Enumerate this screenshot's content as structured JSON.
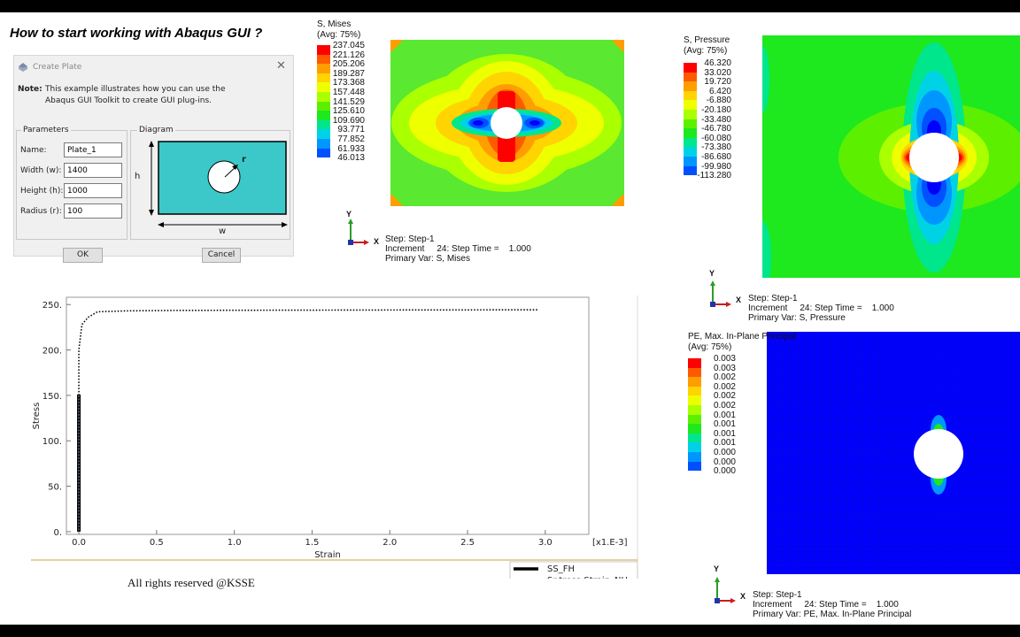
{
  "title": "How to start working  with Abaqus GUI  ?",
  "dialog": {
    "title": "Create Plate",
    "note_label": "Note:",
    "note_line1": "This example illustrates how you can use the",
    "note_line2": "Abaqus GUI Toolkit to create GUI plug-ins.",
    "parameters_label": "Parameters",
    "diagram_label": "Diagram",
    "fields": [
      {
        "label": "Name:",
        "value": "Plate_1"
      },
      {
        "label": "Width (w):",
        "value": "1400"
      },
      {
        "label": "Height (h):",
        "value": "1000"
      },
      {
        "label": "Radius (r):",
        "value": "100"
      }
    ],
    "diagram": {
      "h": "h",
      "w": "w",
      "r": "r"
    },
    "ok_label": "OK",
    "cancel_label": "Cancel"
  },
  "mises_plot": {
    "legend_title1": "S, Mises",
    "legend_title2": "(Avg: 75%)",
    "values": [
      "237.045",
      "221.126",
      "205.206",
      "189.287",
      "173.368",
      "157.448",
      "141.529",
      "125.610",
      "109.690",
      "93.771",
      "77.852",
      "61.933",
      "46.013"
    ],
    "colors": [
      "#ff0000",
      "#ff5a00",
      "#ff9e00",
      "#ffd400",
      "#eeff00",
      "#aaff00",
      "#5cf000",
      "#1ee81e",
      "#00e68c",
      "#00d2e6",
      "#0096ff",
      "#0050ff",
      "#0000ff"
    ],
    "axis_y": "Y",
    "axis_x": "X",
    "info_line1": "Step: Step-1",
    "info_line2": "Increment     24: Step Time =    1.000",
    "info_line3": "Primary Var: S, Mises"
  },
  "pressure_plot": {
    "legend_title1": "S, Pressure",
    "legend_title2": "(Avg: 75%)",
    "values": [
      "46.320",
      "33.020",
      "19.720",
      "6.420",
      "-6.880",
      "-20.180",
      "-33.480",
      "-46.780",
      "-60.080",
      "-73.380",
      "-86.680",
      "-99.980",
      "-113.280"
    ],
    "colors": [
      "#ff0000",
      "#ff5a00",
      "#ff9e00",
      "#ffd400",
      "#eeff00",
      "#aaff00",
      "#5cf000",
      "#1ee81e",
      "#00e68c",
      "#00d2e6",
      "#0096ff",
      "#0050ff",
      "#0000ff"
    ],
    "axis_y": "Y",
    "axis_x": "X",
    "info_line1": "Step: Step-1",
    "info_line2": "Increment     24: Step Time =    1.000",
    "info_line3": "Primary Var: S, Pressure"
  },
  "pe_plot": {
    "legend_title1": "PE, Max. In-Plane Principal",
    "legend_title2": "(Avg: 75%)",
    "values": [
      "0.003",
      "0.003",
      "0.002",
      "0.002",
      "0.002",
      "0.002",
      "0.001",
      "0.001",
      "0.001",
      "0.001",
      "0.000",
      "0.000",
      "0.000"
    ],
    "colors": [
      "#ff0000",
      "#ff5a00",
      "#ff9e00",
      "#ffd400",
      "#eeff00",
      "#aaff00",
      "#5cf000",
      "#1ee81e",
      "#00e68c",
      "#00d2e6",
      "#0096ff",
      "#0050ff",
      "#0000ff"
    ],
    "axis_y": "Y",
    "axis_x": "X",
    "info_line1": "Step: Step-1",
    "info_line2": "Increment     24: Step Time =    1.000",
    "info_line3": "Primary Var: PE, Max. In-Plane Principal"
  },
  "chart_data": {
    "type": "line",
    "xlabel": "Strain",
    "ylabel": "Stress",
    "x_scale_label": "[x1.E-3]",
    "xlim": [
      -0.08,
      3.28
    ],
    "ylim": [
      -3,
      258
    ],
    "x_ticks": [
      "0.0",
      "0.5",
      "1.0",
      "1.5",
      "2.0",
      "2.5",
      "3.0"
    ],
    "y_ticks": [
      "0.",
      "50.",
      "100.",
      "150.",
      "200.",
      "250."
    ],
    "grid": false,
    "legend_position": "bottom-right",
    "series": [
      {
        "name": "SS_FH",
        "style": "solid-thick",
        "x": [
          0.0,
          0.0
        ],
        "y": [
          0.0,
          151.0
        ]
      },
      {
        "name": "Sr-tress-Strain_NH",
        "style": "dotted",
        "x": [
          0.0,
          0.0,
          0.02,
          0.06,
          0.12,
          0.3,
          0.6,
          1.0,
          2.0,
          2.95
        ],
        "y": [
          0.0,
          200.0,
          228.0,
          236.0,
          242.0,
          243.0,
          243.5,
          243.7,
          244.0,
          244.2
        ]
      }
    ]
  },
  "footer": "All rights reserved @KSSE"
}
